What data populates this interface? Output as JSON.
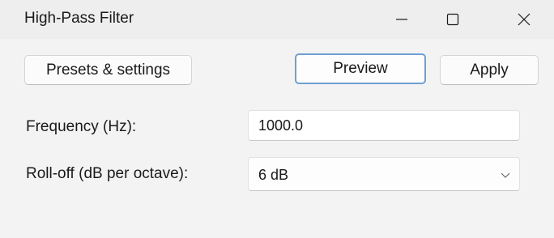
{
  "window": {
    "title": "High-Pass Filter",
    "controls": {
      "minimize": "minimize-icon",
      "maximize": "maximize-icon",
      "close": "close-icon"
    }
  },
  "toolbar": {
    "presets_label": "Presets & settings",
    "preview_label": "Preview",
    "apply_label": "Apply"
  },
  "form": {
    "frequency": {
      "label": "Frequency (Hz):",
      "value": "1000.0"
    },
    "rolloff": {
      "label": "Roll-off (dB per octave):",
      "selected": "6 dB",
      "icon": "chevron-down-icon"
    }
  },
  "colors": {
    "window_bg": "#f3f3f3",
    "titlebar_bg": "#eeeeee",
    "focus_border": "#6f9fd1"
  }
}
